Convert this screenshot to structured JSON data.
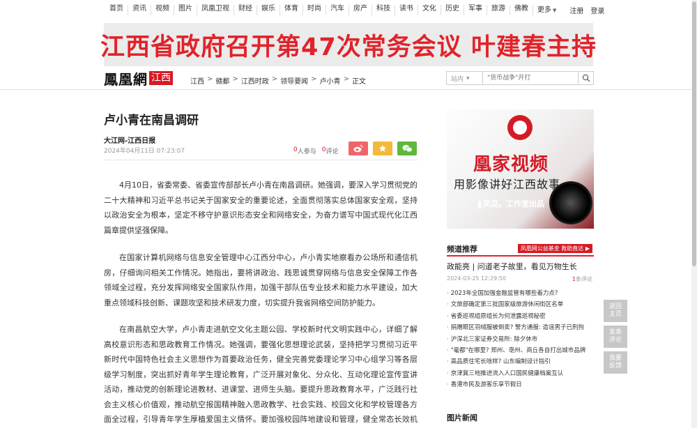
{
  "nav": {
    "links": [
      "首页",
      "资讯",
      "视频",
      "图片",
      "凤凰卫视",
      "财经",
      "娱乐",
      "体育",
      "时尚",
      "汽车",
      "房产",
      "科技",
      "读书",
      "文化",
      "历史",
      "军事",
      "旅游",
      "佛教"
    ],
    "more_label": "更多",
    "register": "注册",
    "login": "登录"
  },
  "banner": {
    "text": "江西省政府召开第47次常务会议 叶建春主持"
  },
  "header": {
    "logo_main": "鳳凰網",
    "logo_sub": "江西",
    "breadcrumbs": [
      "江西",
      "赣鄱",
      "江西时政",
      "领导要闻",
      "卢小青",
      "正文"
    ],
    "search_scope": "站内",
    "search_placeholder": "\"货币战争\"开打"
  },
  "article": {
    "title": "卢小青在南昌调研",
    "source": "大江网-江西日报",
    "date": "2024年04月11日 07:23:07",
    "participants_count": "0",
    "participants_label": "人参与",
    "comments_count": "0",
    "comments_label": "评论",
    "paragraphs": [
      "4月10日，省委常委、省委宣传部部长卢小青在南昌调研。她强调，要深入学习贯彻党的二十大精神和习近平总书记关于国家安全的重要论述，全面贯彻落实总体国家安全观，坚持以政治安全为根本，坚定不移守护意识形态安全和网络安全，为奋力谱写中国式现代化江西篇章提供坚强保障。",
      "在国家计算机网络与信息安全管理中心江西分中心，卢小青实地察看办公场所和通信机房，仔细询问相关工作情况。她指出，要将讲政治、践思诚贯穿网络与信息安全保障工作各领域全过程，充分发挥网络安全国家队作用，加强干部队伍专业技术和能力水平建设，加大重点领域科技创新、课题攻坚和技术研发力度，切实提升我省网络空间防护能力。",
      "在南昌航空大学，卢小青走进航空文化主题公园、学校新时代文明实践中心，详细了解高校意识形态和思政教育工作情况。她强调，要强化思想理论武装，坚持把学习贯彻习近平新时代中国特色社会主义思想作为首要政治任务，健全完善党委理论学习中心组学习等各层级学习制度，突出抓好青年学生理论教育，广泛开展对象化、分众化、互动化理论宣传宣讲活动，推动党的创新理论进教材、进课堂、进师生头脑。要提升思政教育水平，广泛践行社会主义核心价值观，推动航空报国精神融入思政教学、社会实践、校园文化和学校管理各方面全过程，引导青年学生厚植爱国主义情怀。要加强校园阵地建设和管理，健全常态长效机制"
    ]
  },
  "promo": {
    "title": "凰家视频",
    "subtitle": "用影像讲好江西故事",
    "tag": "凤见，工作室出品"
  },
  "sidebar": {
    "section1_title": "频道推荐",
    "ad_tag": "凤凰网公益基金  救助直达",
    "featured_title": "政能亮 | 问道老子故里，看见万物生长",
    "featured_date": "2024-03-25 12:29:50",
    "featured_comment_count": "1",
    "featured_comment_label": "条评论",
    "news": [
      "2023年全国加强金融监管有哪些着力点?",
      "文旅部确定第三批国家级旅游休闲街区名单",
      "省委巡视组原组长为何泄露巡视秘密",
      "捐赠眼区羽绒服被倒卖? 警方通报: 造谣男子已刑拘",
      "沪深北三家证券交易所: 除夕休市",
      "\"毫都\"在哪里? 郑州、亳州、商丘各自打出城市品牌",
      "高品质住宅长啥样? 山东编制设计指引",
      "京津冀三地推进流入人口国民健康档案互认",
      "香港市民及游客乐享节假日"
    ],
    "section2_title": "图片新闻"
  },
  "float": {
    "back_home": "返回主页",
    "post_comment": "发表评论",
    "feedback": "我要反馈"
  }
}
